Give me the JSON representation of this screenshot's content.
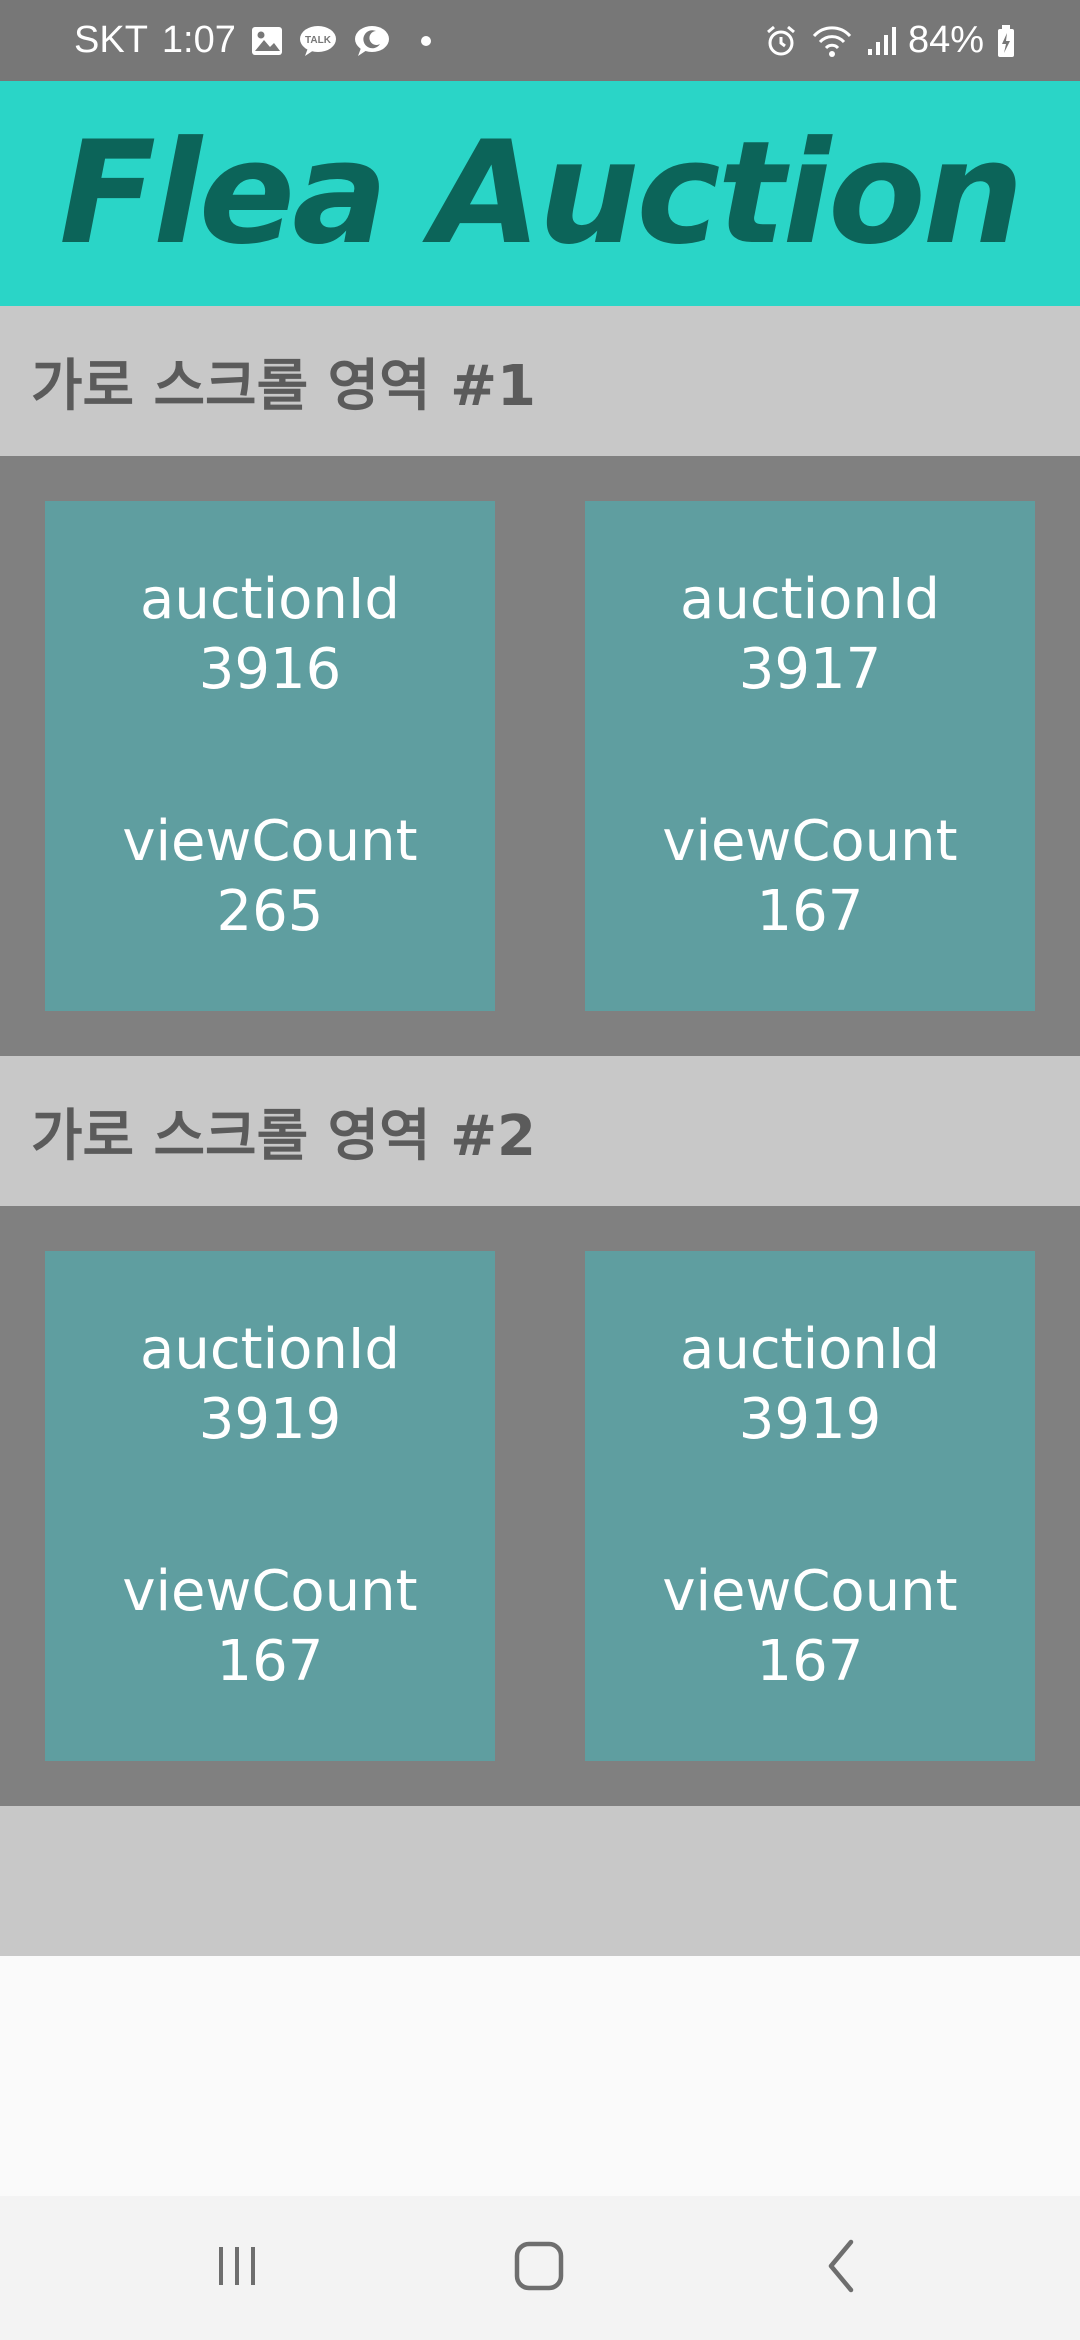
{
  "status_bar": {
    "carrier": "SKT",
    "time": "1:07",
    "battery": "84%",
    "notification_icons": [
      "gallery-icon",
      "kakaotalk-icon",
      "speech-bubble-icon",
      "dot-icon"
    ],
    "status_icons": [
      "alarm-icon",
      "wifi-icon",
      "signal-icon",
      "battery-icon"
    ],
    "talk_label": "TALK"
  },
  "header": {
    "title": "Flea Auction",
    "background": "#2ad5c7",
    "title_color": "#0c6459"
  },
  "sections": [
    {
      "title": "가로 스크롤 영역 #1",
      "cards": [
        {
          "id_label": "auctionId",
          "id_value": "3916",
          "count_label": "viewCount",
          "count_value": "265"
        },
        {
          "id_label": "auctionId",
          "id_value": "3917",
          "count_label": "viewCount",
          "count_value": "167"
        }
      ]
    },
    {
      "title": "가로 스크롤 영역 #2",
      "cards": [
        {
          "id_label": "auctionId",
          "id_value": "3919",
          "count_label": "viewCount",
          "count_value": "167"
        },
        {
          "id_label": "auctionId",
          "id_value": "3919",
          "count_label": "viewCount",
          "count_value": "167"
        }
      ]
    }
  ],
  "colors": {
    "card": "#5f9ea0",
    "scroll_area": "#808080",
    "section_header": "#c8c8c8"
  },
  "nav_bar": {
    "buttons": [
      "recent-apps-icon",
      "home-icon",
      "back-icon"
    ]
  }
}
